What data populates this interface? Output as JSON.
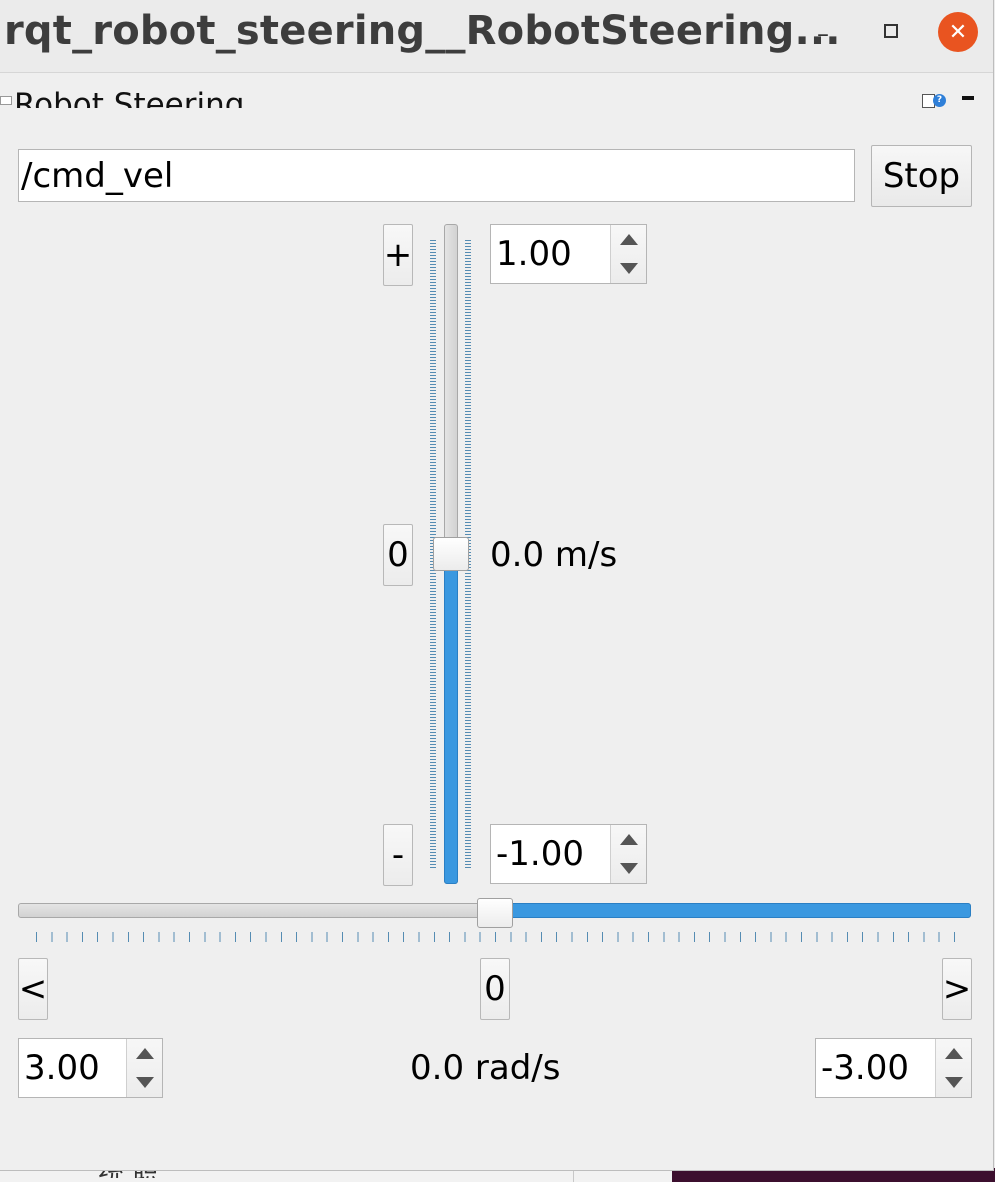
{
  "window": {
    "title": "rqt_robot_steering__RobotSteering...",
    "minimize_glyph": "–",
    "close_glyph": "✕"
  },
  "dock": {
    "title": "Robot Steering",
    "help_glyph": "?"
  },
  "topic": {
    "value": "/cmd_vel"
  },
  "stop_label": "Stop",
  "linear": {
    "increase_label": "+",
    "zero_label": "0",
    "decrease_label": "-",
    "max_value": "1.00",
    "min_value": "-1.00",
    "readout": "0.0 m/s",
    "value": 0.0,
    "range": [
      -1.0,
      1.0
    ]
  },
  "angular": {
    "left_label": "<",
    "zero_label": "0",
    "right_label": ">",
    "max_value": "3.00",
    "min_value": "-3.00",
    "readout": "0.0 rad/s",
    "value": 0.0,
    "range": [
      -3.0,
      3.0
    ]
  },
  "background_text": "统 职",
  "colors": {
    "accent": "#3a98e0",
    "close_button": "#e95420"
  }
}
